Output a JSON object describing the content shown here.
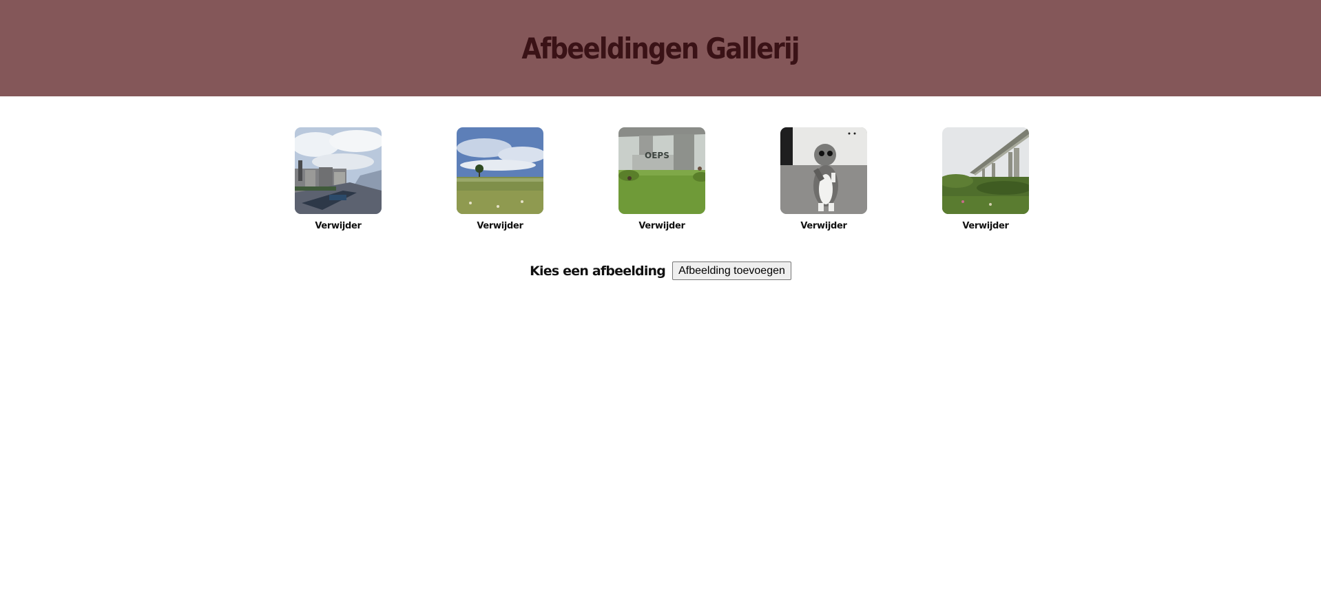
{
  "header": {
    "title": "Afbeeldingen Gallerij"
  },
  "gallery": {
    "items": [
      {
        "image": "river-quay-photo",
        "remove_label": "Verwijder"
      },
      {
        "image": "meadow-sky-photo",
        "remove_label": "Verwijder"
      },
      {
        "image": "bridge-graffiti-photo",
        "remove_label": "Verwijder"
      },
      {
        "image": "cat-photo",
        "remove_label": "Verwijder"
      },
      {
        "image": "bridge-field-photo",
        "remove_label": "Verwijder"
      }
    ]
  },
  "upload": {
    "label": "Kies een afbeelding",
    "button_label": "Afbeelding toevoegen"
  },
  "colors": {
    "header_bg": "#845759",
    "title": "#3a1216"
  }
}
